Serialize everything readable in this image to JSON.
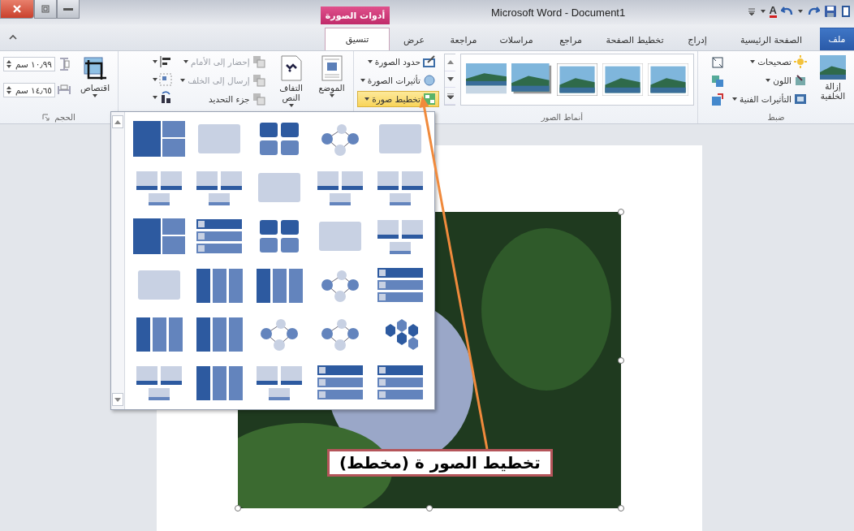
{
  "title_bar": {
    "title": "Microsoft Word - Document1",
    "context_tab": "أدوات الصورة",
    "font_color_glyph": "A"
  },
  "tabs": [
    {
      "label": "ملف",
      "kind": "file",
      "selected": false
    },
    {
      "label": "الصفحة الرئيسية",
      "kind": "tab",
      "selected": false
    },
    {
      "label": "إدراج",
      "kind": "tab",
      "selected": false
    },
    {
      "label": "تخطيط الصفحة",
      "kind": "tab",
      "selected": false
    },
    {
      "label": "مراجع",
      "kind": "tab",
      "selected": false
    },
    {
      "label": "مراسلات",
      "kind": "tab",
      "selected": false
    },
    {
      "label": "مراجعة",
      "kind": "tab",
      "selected": false
    },
    {
      "label": "عرض",
      "kind": "tab",
      "selected": false
    },
    {
      "label": "تنسيق",
      "kind": "tab",
      "selected": true
    }
  ],
  "ribbon": {
    "adjust": {
      "label": "ضبط",
      "remove_background": "إزالة الخلفية",
      "buttons": [
        "تصحيحات",
        "اللون",
        "التأثيرات الفنية"
      ]
    },
    "picture_styles": {
      "label": "أنماط الصور",
      "styles": [
        {
          "kind": "frame"
        },
        {
          "kind": "frame"
        },
        {
          "kind": "thin-frame"
        },
        {
          "kind": "shadow"
        },
        {
          "kind": "reflection"
        }
      ],
      "commands": [
        {
          "label": "حدود الصورة",
          "pressed": false
        },
        {
          "label": "تأثيرات الصورة",
          "pressed": false
        },
        {
          "label": "تخطيط صورة",
          "pressed": true
        }
      ]
    },
    "arrange": {
      "position": "الموضع",
      "wrap_text": "التفاف النص",
      "commands": [
        {
          "label": "إحضار إلى الأمام",
          "disabled": true
        },
        {
          "label": "إرسال إلى الخلف",
          "disabled": true
        },
        {
          "label": "جزء التحديد",
          "disabled": false
        }
      ]
    },
    "size": {
      "label": "الحجم",
      "crop": "اقتصاص",
      "height": "١٠٫٩٩ سم",
      "width": "١٤٫٦٥ سم"
    }
  },
  "layout_gallery": {
    "items": [
      {
        "kind": "blocks"
      },
      {
        "kind": "light"
      },
      {
        "kind": "tiles"
      },
      {
        "kind": "circles"
      },
      {
        "kind": "light"
      },
      {
        "kind": "captions"
      },
      {
        "kind": "captions"
      },
      {
        "kind": "light"
      },
      {
        "kind": "captions"
      },
      {
        "kind": "captions"
      },
      {
        "kind": "blocks"
      },
      {
        "kind": "list"
      },
      {
        "kind": "tiles"
      },
      {
        "kind": "light"
      },
      {
        "kind": "captions"
      },
      {
        "kind": "light"
      },
      {
        "kind": "columns"
      },
      {
        "kind": "columns"
      },
      {
        "kind": "circles"
      },
      {
        "kind": "list"
      },
      {
        "kind": "columns"
      },
      {
        "kind": "columns"
      },
      {
        "kind": "circles"
      },
      {
        "kind": "circles"
      },
      {
        "kind": "hexagons"
      },
      {
        "kind": "captions"
      },
      {
        "kind": "columns"
      },
      {
        "kind": "captions"
      },
      {
        "kind": "list"
      },
      {
        "kind": "list"
      }
    ]
  },
  "callout": "تخطيط الصور ة (مخطط)"
}
